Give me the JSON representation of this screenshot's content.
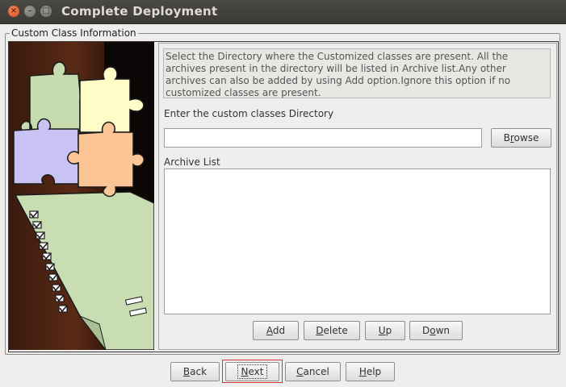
{
  "window": {
    "title": "Complete Deployment",
    "controls": [
      "close-icon",
      "minimize-icon",
      "maximize-icon"
    ]
  },
  "group": {
    "label": "Custom Class Information"
  },
  "content": {
    "info_text": "Select the Directory where the Customized classes are present. All the archives present in the directory will be listed in Archive list.Any other archives can also be added by using Add option.Ignore this option if no customized classes are present.",
    "directory_label": "Enter the custom classes Directory",
    "directory_value": "",
    "browse_button": {
      "prefix": "B",
      "mnemonic": "r",
      "suffix": "owse"
    },
    "archive_label": "Archive List",
    "archive_items": [],
    "list_buttons": {
      "add": {
        "prefix": "",
        "mnemonic": "A",
        "suffix": "dd"
      },
      "delete": {
        "prefix": "",
        "mnemonic": "D",
        "suffix": "elete"
      },
      "up": {
        "prefix": "",
        "mnemonic": "U",
        "suffix": "p"
      },
      "down": {
        "prefix": "D",
        "mnemonic": "o",
        "suffix": "wn"
      }
    }
  },
  "footer": {
    "back": {
      "prefix": "",
      "mnemonic": "B",
      "suffix": "ack"
    },
    "next": {
      "prefix": "",
      "mnemonic": "N",
      "suffix": "ext"
    },
    "cancel": {
      "prefix": "",
      "mnemonic": "C",
      "suffix": "ancel"
    },
    "help": {
      "prefix": "",
      "mnemonic": "H",
      "suffix": "elp"
    },
    "focused": "next"
  },
  "colors": {
    "titlebar": "#3c3b37",
    "close_button": "#e8562a",
    "focus_ring": "#d23a3a",
    "window_bg": "#efeeec"
  }
}
